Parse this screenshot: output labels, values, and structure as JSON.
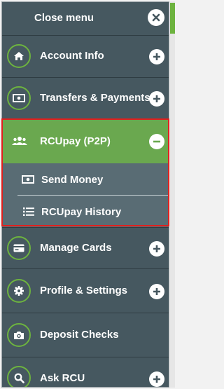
{
  "menu": {
    "close_label": "Close menu",
    "items": [
      {
        "label": "Account Info",
        "icon": "home-icon"
      },
      {
        "label": "Transfers & Payments",
        "icon": "money-icon"
      },
      {
        "label": "RCUpay (P2P)",
        "icon": "people-icon",
        "expanded": true
      },
      {
        "label": "Manage Cards",
        "icon": "card-icon"
      },
      {
        "label": "Profile & Settings",
        "icon": "gear-icon"
      },
      {
        "label": "Deposit Checks",
        "icon": "camera-icon"
      },
      {
        "label": "Ask RCU",
        "icon": "search-icon"
      }
    ],
    "submenu": [
      {
        "label": "Send Money",
        "icon": "money-icon"
      },
      {
        "label": "RCUpay History",
        "icon": "list-icon"
      }
    ]
  },
  "colors": {
    "accent": "#6db33f",
    "active_bg": "#6aa84f",
    "panel_bg": "#465860",
    "submenu_bg": "#596c74",
    "highlight": "#e0201d"
  }
}
